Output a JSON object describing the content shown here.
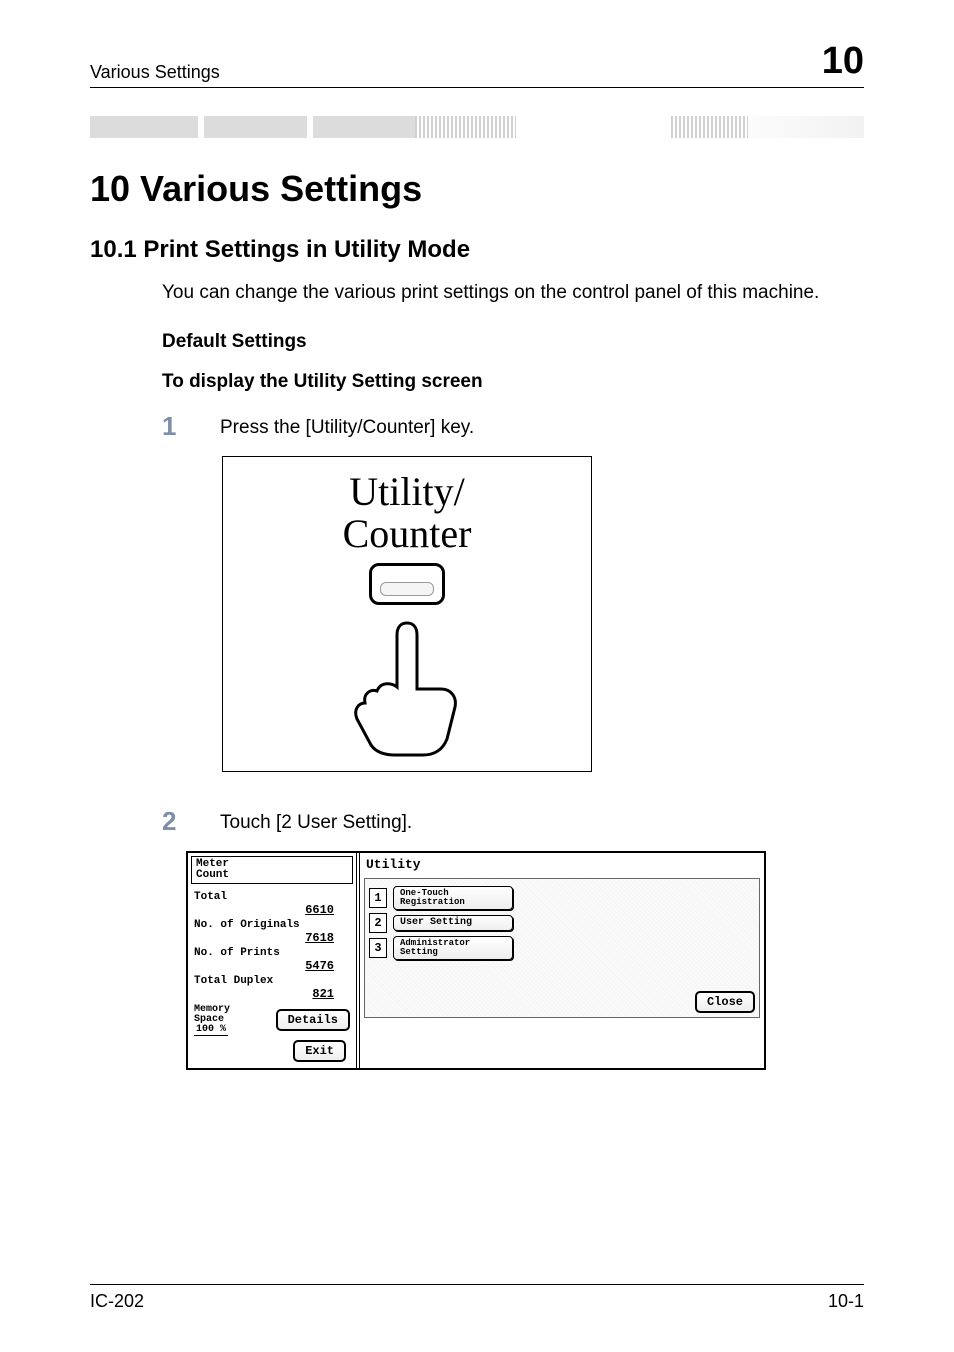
{
  "header": {
    "running_left": "Various Settings",
    "chapter_number": "10"
  },
  "chapter": {
    "title": "10   Various Settings"
  },
  "section": {
    "number_title": "10.1   Print Settings in Utility Mode",
    "intro": "You can change the various print settings on the control panel of this machine.",
    "sub1": "Default Settings",
    "sub2": "To display the Utility Setting screen"
  },
  "steps": {
    "s1_num": "1",
    "s1_text": "Press the [Utility/Counter] key.",
    "s2_num": "2",
    "s2_text": "Touch [2 User Setting]."
  },
  "keycap": {
    "line1": "Utility/",
    "line2": "Counter"
  },
  "panel": {
    "meter_title": "Meter\nCount",
    "total_label": "Total",
    "total_value": "6610",
    "orig_label": "No. of Originals",
    "orig_value": "7618",
    "prints_label": "No. of Prints",
    "prints_value": "5476",
    "duplex_label": "Total Duplex",
    "duplex_value": "821",
    "memory_label": "Memory\nSpace",
    "memory_pct": "100 %",
    "details_btn": "Details",
    "exit_btn": "Exit",
    "utility_title": "Utility",
    "menu": {
      "i1_num": "1",
      "i1_label": "One-Touch\nRegistration",
      "i2_num": "2",
      "i2_label": "User Setting",
      "i3_num": "3",
      "i3_label": "Administrator\nSetting"
    },
    "close_btn": "Close"
  },
  "footer": {
    "left": "IC-202",
    "right": "10-1"
  }
}
